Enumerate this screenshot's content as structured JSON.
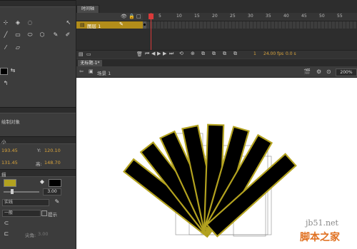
{
  "timeline": {
    "tab_label": "时间轴",
    "layer_name": "图层 1",
    "ruler_marks": [
      "1",
      "5",
      "10",
      "15",
      "20",
      "25",
      "30",
      "35",
      "40",
      "45",
      "50",
      "55"
    ],
    "current_frame": "1",
    "fps": "24.00 fps",
    "time": "0.0 s"
  },
  "document": {
    "tab_label": "无标题-1*",
    "scene_label": "场景 1",
    "zoom": "200%"
  },
  "properties": {
    "object_label": "绘制对象",
    "section_position": "小",
    "x_label": "",
    "x_value": "193.45",
    "y_label": "Y:",
    "y_value": "120.10",
    "w_value": "131.45",
    "h_label": "高:",
    "h_value": "148.70",
    "section_fill": "描",
    "stroke_width": "3.00",
    "style_value": "实线",
    "scale_value": "一般",
    "hint_label": "提示",
    "join_label": "尖角:",
    "join_value": "3.00"
  },
  "colors": {
    "stroke": "#b3a21f",
    "fill": "#000000",
    "layer_highlight": "#b28d1a"
  },
  "watermark": {
    "line1": "jb51.net",
    "line2": "脚本之家"
  }
}
